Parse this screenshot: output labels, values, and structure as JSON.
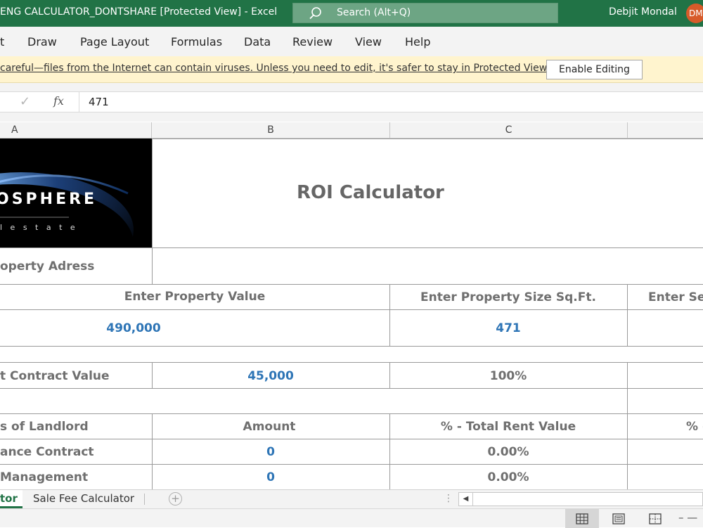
{
  "titlebar": {
    "doc_title": "ENG CALCULATOR_DONTSHARE  [Protected View]  -  Excel",
    "search_placeholder": "Search (Alt+Q)",
    "user_name": "Debjit Mondal",
    "user_initials": "DM"
  },
  "ribbon": {
    "tabs": [
      "t",
      "Draw",
      "Page Layout",
      "Formulas",
      "Data",
      "Review",
      "View",
      "Help"
    ]
  },
  "protected_view": {
    "message": "careful—files from the Internet can contain viruses. Unless you need to edit, it's safer to stay in Protected View.",
    "enable_button": "Enable Editing"
  },
  "formula_bar": {
    "check_symbol": "✓",
    "fx_symbol": "fx",
    "value": "471"
  },
  "columns": [
    "A",
    "B",
    "C"
  ],
  "sheet": {
    "logo_text": "OSPHERE",
    "logo_subtext": "l   e s t a t e",
    "title": "ROI Calculator",
    "property_address_label": "operty Adress",
    "property_value_label": "Enter Property Value",
    "property_size_label": "Enter Property Size Sq.Ft.",
    "col_d_label": "Enter Se",
    "property_value": "490,000",
    "property_size": "471",
    "contract_value_label": "t Contract Value",
    "contract_value": "45,000",
    "contract_pct": "100%",
    "landlord_label": "s of Landlord",
    "amount_label": "Amount",
    "pct_total_label": "% - Total Rent Value",
    "col_d_pct_label": "% -",
    "rows": [
      {
        "label": "ance Contract",
        "amount": "0",
        "pct": "0.00%"
      },
      {
        "label": "Management",
        "amount": "0",
        "pct": "0.00%"
      }
    ]
  },
  "sheet_tabs": {
    "active": "tor",
    "other": "Sale Fee Calculator",
    "add_symbol": "+"
  },
  "statusbar": {
    "zoom_symbol": "–  —"
  },
  "colors": {
    "excel_green": "#217346",
    "value_blue": "#2e75b6",
    "label_gray": "#6f6f6f",
    "protected_bar": "#fff4ce"
  }
}
